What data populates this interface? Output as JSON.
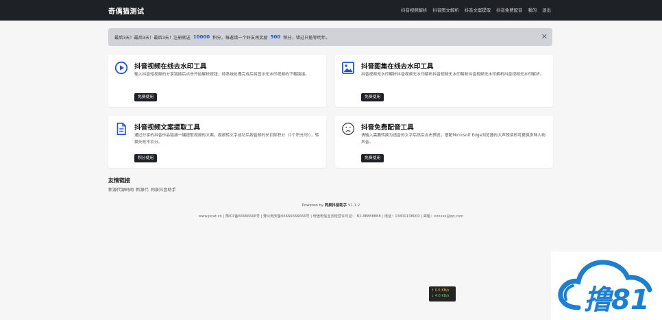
{
  "header": {
    "brand": "奇偶猫测试",
    "nav": [
      "抖音视频解析",
      "抖音图文解析",
      "抖音文案提取",
      "抖音免费配音",
      "我的",
      "退出"
    ]
  },
  "alert": {
    "text_before": "最后3天！最后3天！最后3天！注册就送",
    "num1": "10000",
    "text_mid": "积分，每邀请一个好友再奖励",
    "num2": "500",
    "text_after": "积分，错过只能等明年。",
    "close": "✕"
  },
  "cards": [
    {
      "icon": "play-circle-icon",
      "title": "抖音视频在线去水印工具",
      "desc": "输入抖音短视频的分享链接后点击开始解析按钮，待系统处理完成后将显示无水印视频的下载链接。",
      "button": "免费使用"
    },
    {
      "icon": "image-gallery-icon",
      "title": "抖音图集在线去水印工具",
      "desc": "抖音视频无水印解析抖音视频无水印解析抖音视频无水印解析抖音视频无水印解析抖音视频无水印解析。",
      "button": "免费使用"
    },
    {
      "icon": "document-icon",
      "title": "抖音视频文案提取工具",
      "desc": "通过分享的抖音作品链接一键提取视频的文案，视频转文字成功后按音频时长扣除积分（1个积分/秒），转换失败不扣分。",
      "button": "积分使用"
    },
    {
      "icon": "sad-face-icon",
      "title": "抖音免费配音工具",
      "desc": "请输入需要转换为语音的文字后然后点击预览，搭配Microsoft Edge浏览器的大声朗读即可更换多种人物声音。",
      "button": "免费使用"
    }
  ],
  "friends": {
    "title": "友情链接",
    "links": [
      "新源代源码网",
      "新源代",
      "同泉抖音助手"
    ]
  },
  "powered": {
    "prefix": "Powered by",
    "name": "同泉抖音助手",
    "version": "V1.1.2"
  },
  "footer": "www.jscat.cn | 豫ICP备66666666号 | 豫公网安备66666666666号 | 增值电信业务经营许可证： B2-88888888 | 电话：13800138000 | 邮箱：xxxxxx@qq.com",
  "speed": {
    "up": "↑ 0.5 KB/s",
    "down": "↓ 4.0 KB/s"
  },
  "watermark": {
    "text": "撸81",
    "color": "#1a7fd6"
  }
}
